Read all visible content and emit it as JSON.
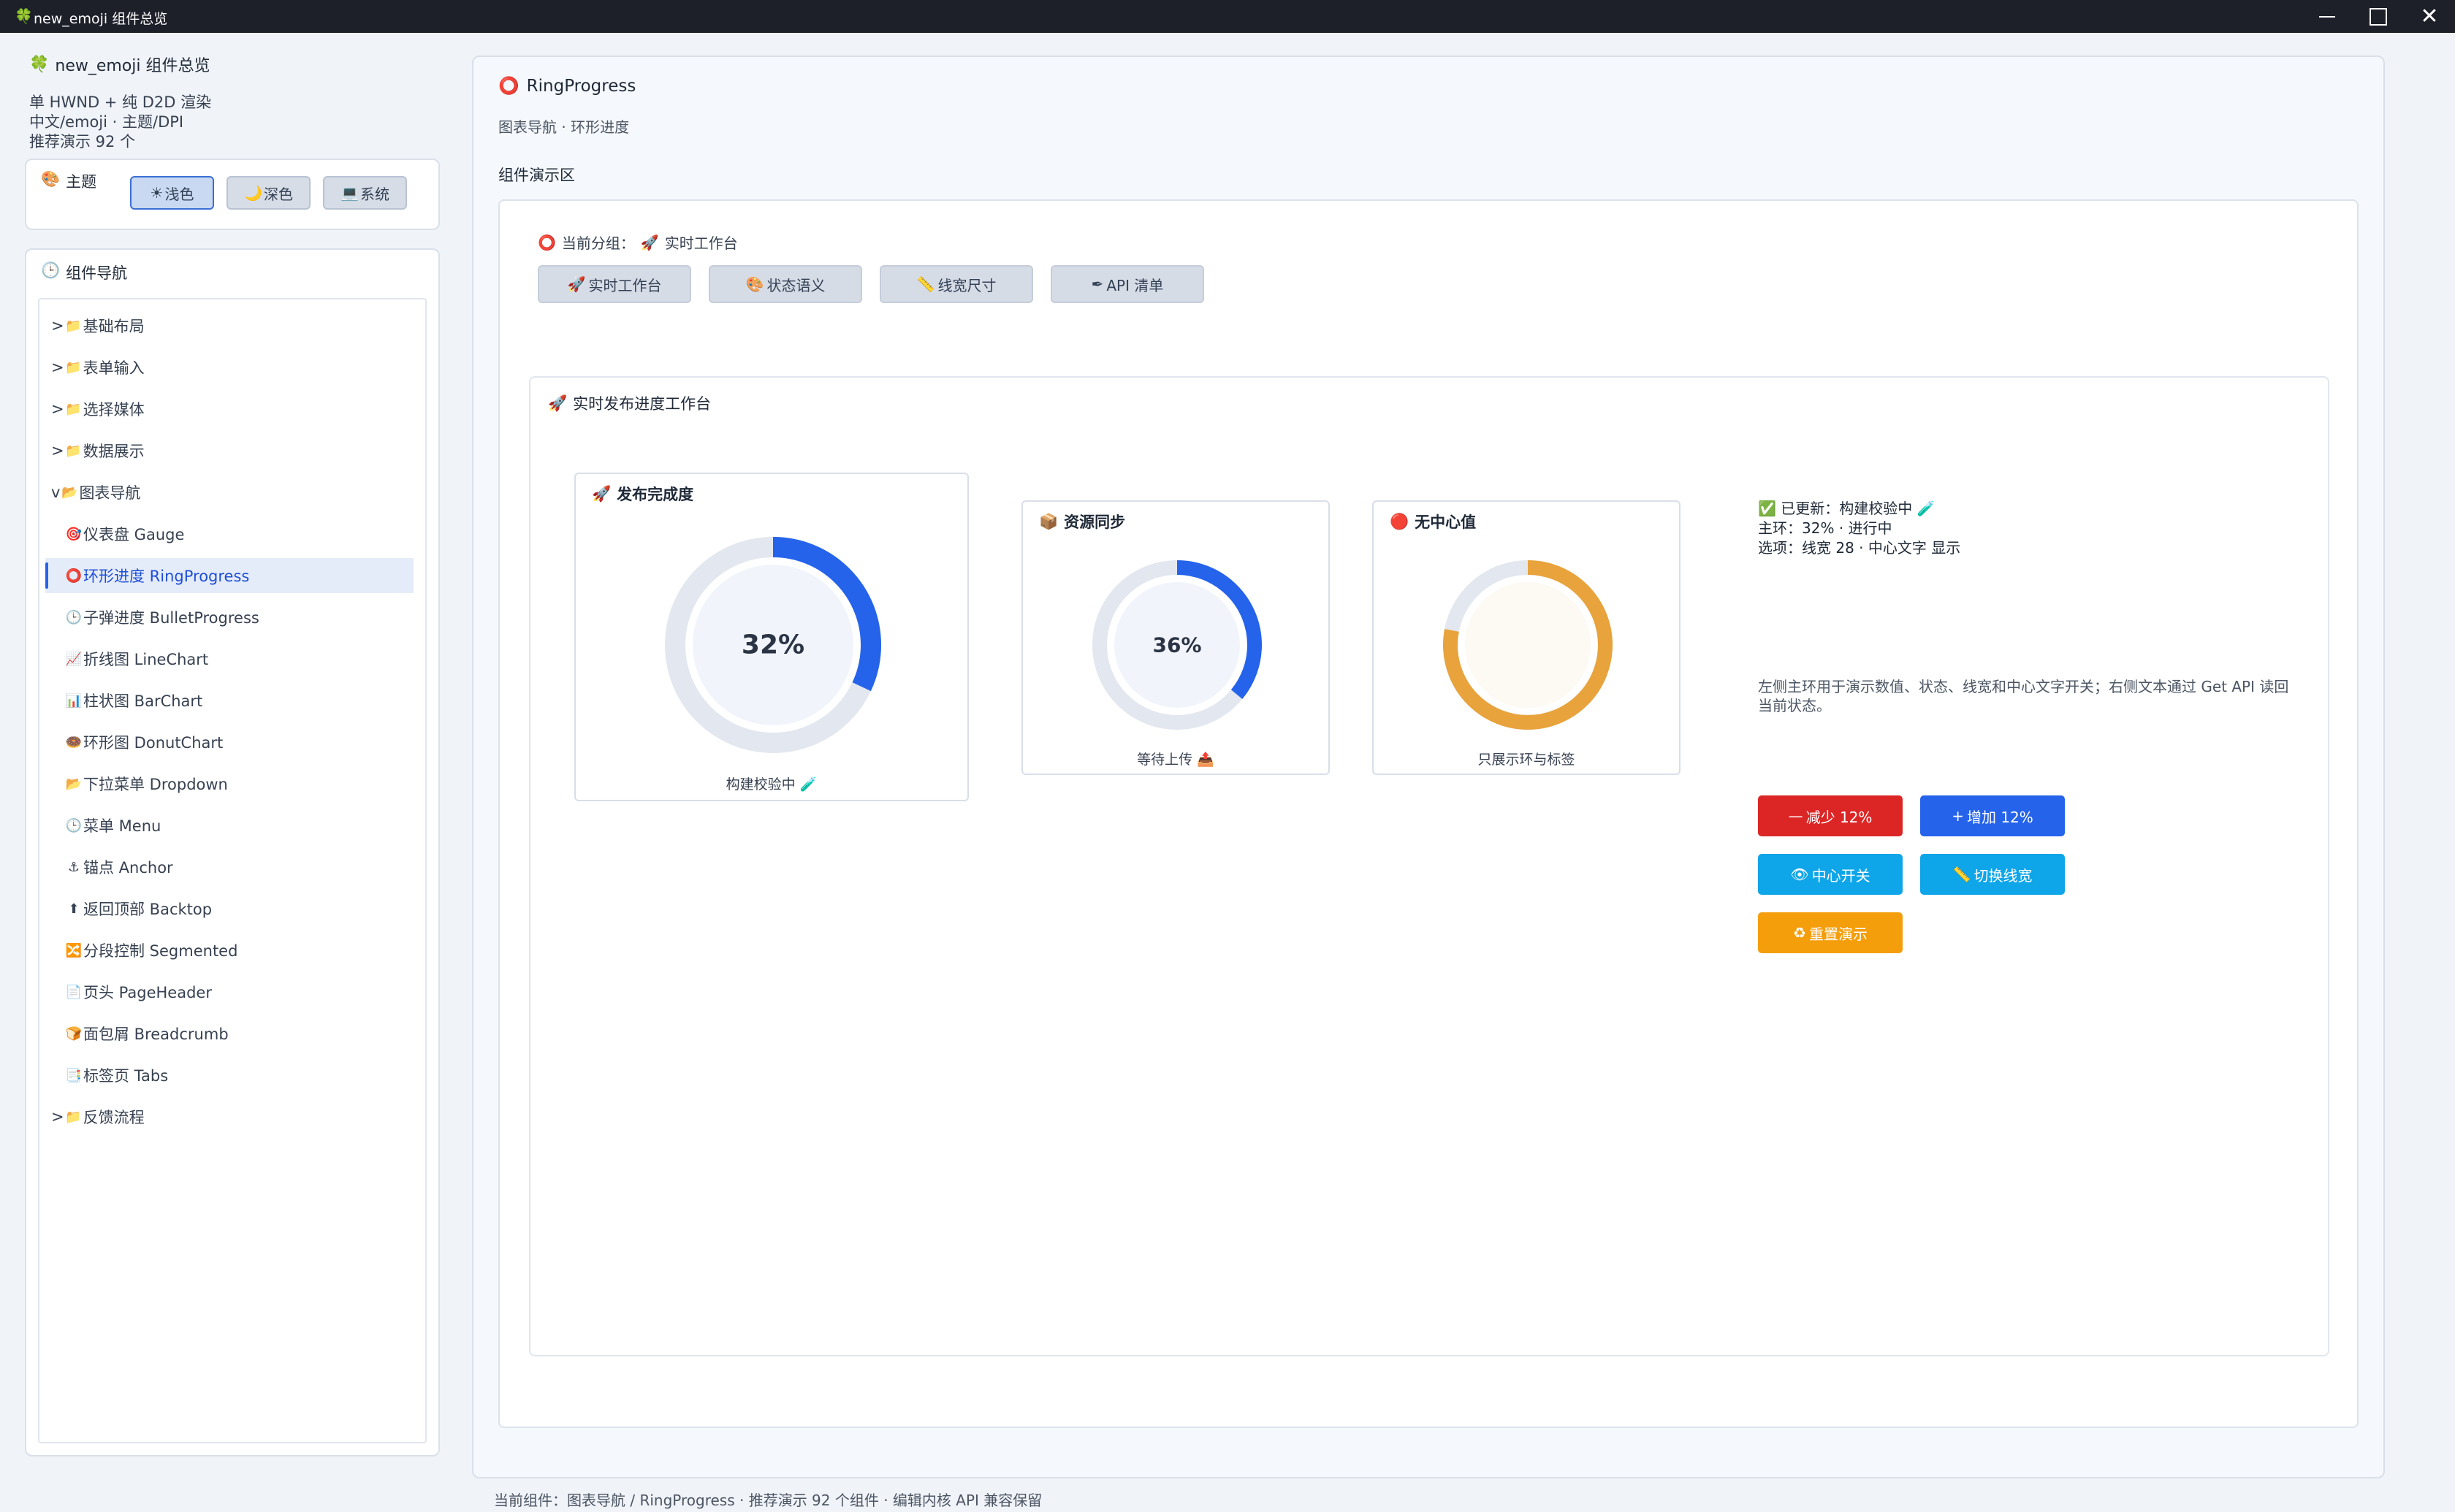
{
  "window": {
    "title": "new_emoji 组件总览",
    "icon": "clover-icon",
    "controls": [
      "minimize",
      "maximize",
      "close"
    ]
  },
  "sidebar": {
    "app_title": "new_emoji 组件总览",
    "info": [
      "单 HWND + 纯 D2D 渲染",
      "中文/emoji · 主题/DPI",
      "推荐演示 92 个"
    ],
    "theme": {
      "label": "主题",
      "options": [
        {
          "icon": "☀",
          "label": "浅色",
          "active": true
        },
        {
          "icon": "🌙",
          "label": "深色",
          "active": false
        },
        {
          "icon": "💻",
          "label": "系统",
          "active": false
        }
      ]
    },
    "nav": {
      "title": "组件导航",
      "items": [
        {
          "prefix": ">",
          "icon": "📁",
          "label": "基础布局",
          "level": 0
        },
        {
          "prefix": ">",
          "icon": "📁",
          "label": "表单输入",
          "level": 0
        },
        {
          "prefix": ">",
          "icon": "📁",
          "label": "选择媒体",
          "level": 0
        },
        {
          "prefix": ">",
          "icon": "📁",
          "label": "数据展示",
          "level": 0
        },
        {
          "prefix": "v",
          "icon": "📂",
          "label": "图表导航",
          "level": 0
        },
        {
          "prefix": "",
          "icon": "🎯",
          "label": "仪表盘 Gauge",
          "level": 1
        },
        {
          "prefix": "",
          "icon": "⭕",
          "label": "环形进度 RingProgress",
          "level": 1,
          "selected": true
        },
        {
          "prefix": "",
          "icon": "🕒",
          "label": "子弹进度 BulletProgress",
          "level": 1
        },
        {
          "prefix": "",
          "icon": "📈",
          "label": "折线图 LineChart",
          "level": 1
        },
        {
          "prefix": "",
          "icon": "📊",
          "label": "柱状图 BarChart",
          "level": 1
        },
        {
          "prefix": "",
          "icon": "🍩",
          "label": "环形图 DonutChart",
          "level": 1
        },
        {
          "prefix": "",
          "icon": "📂",
          "label": "下拉菜单 Dropdown",
          "level": 1
        },
        {
          "prefix": "",
          "icon": "🕒",
          "label": "菜单 Menu",
          "level": 1
        },
        {
          "prefix": "",
          "icon": "⚓",
          "label": "锚点 Anchor",
          "level": 1
        },
        {
          "prefix": "",
          "icon": "⬆",
          "label": "返回顶部 Backtop",
          "level": 1
        },
        {
          "prefix": "",
          "icon": "🔀",
          "label": "分段控制 Segmented",
          "level": 1
        },
        {
          "prefix": "",
          "icon": "📄",
          "label": "页头 PageHeader",
          "level": 1
        },
        {
          "prefix": "",
          "icon": "🍞",
          "label": "面包屑 Breadcrumb",
          "level": 1
        },
        {
          "prefix": "",
          "icon": "📑",
          "label": "标签页 Tabs",
          "level": 1
        },
        {
          "prefix": ">",
          "icon": "📁",
          "label": "反馈流程",
          "level": 0
        }
      ]
    }
  },
  "main": {
    "title": "RingProgress",
    "subtitle": "图表导航 · 环形进度",
    "demo_label": "组件演示区",
    "group_prefix": "当前分组：",
    "group_icon": "🚀",
    "group_name": "实时工作台",
    "group_buttons": [
      {
        "icon": "🚀",
        "label": "实时工作台"
      },
      {
        "icon": "🎨",
        "label": "状态语义"
      },
      {
        "icon": "📏",
        "label": "线宽尺寸"
      },
      {
        "icon": "✒",
        "label": "API 清单"
      }
    ],
    "workbench": {
      "title": "实时发布进度工作台",
      "rings": [
        {
          "title": "发布完成度",
          "icon": "🚀",
          "value": 0.32,
          "label": "32%",
          "caption": "构建校验中 🧪",
          "color": "#2563eb",
          "track": "#e3e7ef",
          "center": "#f1f5fb",
          "show_center": true
        },
        {
          "title": "资源同步",
          "icon": "📦",
          "value": 0.36,
          "label": "36%",
          "caption": "等待上传 📤",
          "color": "#2563eb",
          "track": "#e3e7ef",
          "center": "#f1f5fb",
          "show_center": true
        },
        {
          "title": "无中心值",
          "icon": "🔴",
          "value": 0.78,
          "label": "",
          "caption": "只展示环与标签",
          "color": "#e8a33c",
          "track": "#e3e7ef",
          "center": "#fdf9f3",
          "show_center": false
        }
      ],
      "status": {
        "line1": "✅ 已更新：构建校验中 🧪",
        "line2": "主环：32% · 进行中",
        "line3": "选项：线宽 28 · 中心文字 显示"
      },
      "description": "左侧主环用于演示数值、状态、线宽和中心文字开关；右侧文本通过 Get API 读回当前状态。",
      "actions": [
        {
          "icon": "—",
          "label": "减少 12%",
          "color": "#dc2626"
        },
        {
          "icon": "+",
          "label": "增加 12%",
          "color": "#2563eb"
        },
        {
          "icon": "👁",
          "label": "中心开关",
          "color": "#0ea5e9"
        },
        {
          "icon": "📏",
          "label": "切换线宽",
          "color": "#0ea5e9"
        },
        {
          "icon": "♻",
          "label": "重置演示",
          "color": "#f59e0b"
        }
      ]
    }
  },
  "footer": "当前组件：图表导航 / RingProgress · 推荐演示 92 个组件 · 编辑内核 API 兼容保留"
}
